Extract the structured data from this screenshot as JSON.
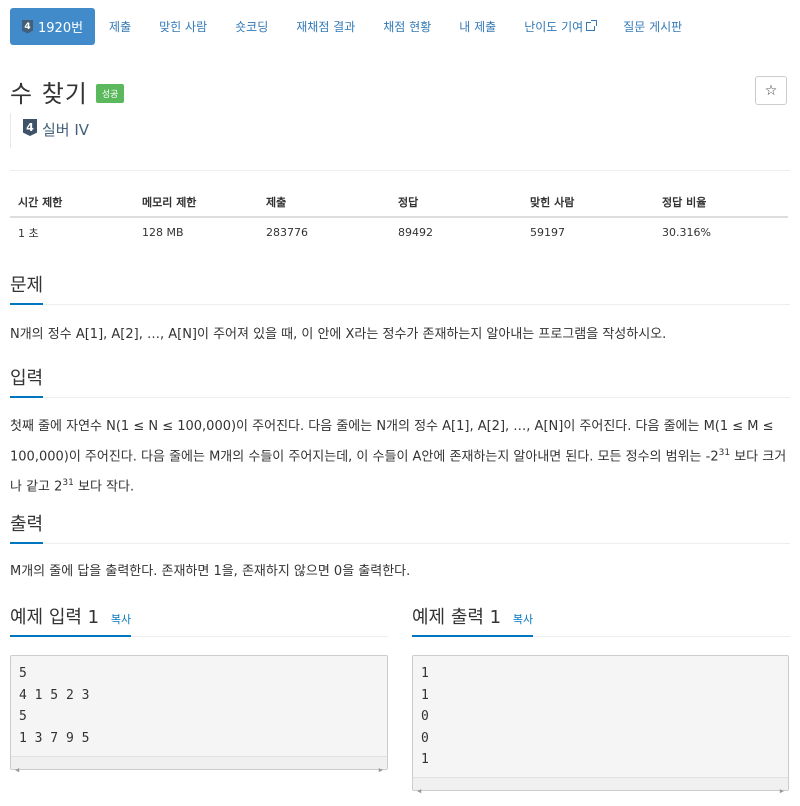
{
  "nav": {
    "problem_tier": "4",
    "problem_id": "1920번",
    "items": [
      "제출",
      "맞힌 사람",
      "숏코딩",
      "재채점 결과",
      "채점 현황",
      "내 제출",
      "난이도 기여",
      "질문 게시판"
    ]
  },
  "problem": {
    "title": "수 찾기",
    "result_badge": "성공",
    "star": "☆",
    "tier_number": "4",
    "tier_text": "실버 IV"
  },
  "stats": {
    "headers": [
      "시간 제한",
      "메모리 제한",
      "제출",
      "정답",
      "맞힌 사람",
      "정답 비율"
    ],
    "values": [
      "1 초",
      "128 MB",
      "283776",
      "89492",
      "59197",
      "30.316%"
    ]
  },
  "sections": {
    "problem_title": "문제",
    "problem_text": "N개의 정수 A[1], A[2], …, A[N]이 주어져 있을 때, 이 안에 X라는 정수가 존재하는지 알아내는 프로그램을 작성하시오.",
    "input_title": "입력",
    "input_text_1": "첫째 줄에 자연수 N(1 ≤ N ≤ 100,000)이 주어진다. 다음 줄에는 N개의 정수 A[1], A[2], …, A[N]이 주어진다. 다음 줄에는 M(1 ≤ M ≤ 100,000)이 주어진다. 다음 줄에는 M개의 수들이 주어지는데, 이 수들이 A안에 존재하는지 알아내면 된다. 모든 정수의 범위는 -2",
    "input_sup_1": "31",
    "input_text_2": " 보다 크거나 같고 2",
    "input_sup_2": "31",
    "input_text_3": " 보다 작다.",
    "output_title": "출력",
    "output_text": "M개의 줄에 답을 출력한다. 존재하면 1을, 존재하지 않으면 0을 출력한다."
  },
  "examples": {
    "input_title": "예제 입력 1",
    "output_title": "예제 출력 1",
    "copy_label": "복사",
    "input_content": "5\n4 1 5 2 3\n5\n1 3 7 9 5",
    "output_content": "1\n1\n0\n0\n1"
  }
}
